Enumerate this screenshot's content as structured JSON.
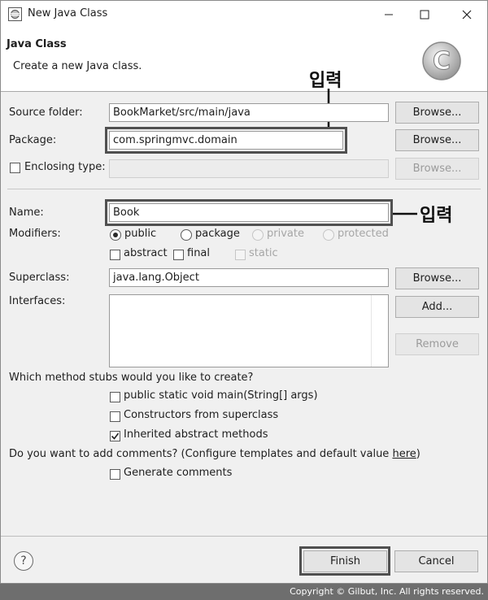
{
  "window": {
    "title": "New Java Class",
    "controls": {
      "minimize": "—",
      "maximize": "☐",
      "close": "✕"
    }
  },
  "header": {
    "title": "Java Class",
    "subtitle": "Create a new Java class.",
    "logo_letter": "C"
  },
  "form": {
    "source_folder": {
      "label": "Source folder:",
      "value": "BookMarket/src/main/java",
      "button": "Browse..."
    },
    "package": {
      "label": "Package:",
      "value": "com.springmvc.domain",
      "button": "Browse..."
    },
    "enclosing_type": {
      "label": "Enclosing type:",
      "checked": false,
      "value": "",
      "button": "Browse..."
    },
    "name": {
      "label": "Name:",
      "value": "Book"
    },
    "modifiers": {
      "label": "Modifiers:",
      "radios": [
        "public",
        "package",
        "private",
        "protected"
      ],
      "selected": "public",
      "checkboxes": [
        "abstract",
        "final",
        "static"
      ]
    },
    "superclass": {
      "label": "Superclass:",
      "value": "java.lang.Object",
      "button": "Browse..."
    },
    "interfaces": {
      "label": "Interfaces:",
      "add_button": "Add...",
      "remove_button": "Remove"
    },
    "stubs": {
      "question": "Which method stubs would you like to create?",
      "options": [
        {
          "label": "public static void main(String[] args)",
          "checked": false
        },
        {
          "label": "Constructors from superclass",
          "checked": false
        },
        {
          "label": "Inherited abstract methods",
          "checked": true
        }
      ]
    },
    "comments": {
      "question_prefix": "Do you want to add comments? (Configure templates and default value ",
      "link": "here",
      "question_suffix": ")",
      "option": {
        "label": "Generate comments",
        "checked": false
      }
    }
  },
  "annotations": {
    "package_note": "입력",
    "name_note": "입력"
  },
  "buttons": {
    "help": "?",
    "finish": "Finish",
    "cancel": "Cancel"
  },
  "copyright": "Copyright © Gilbut, Inc. All rights reserved."
}
